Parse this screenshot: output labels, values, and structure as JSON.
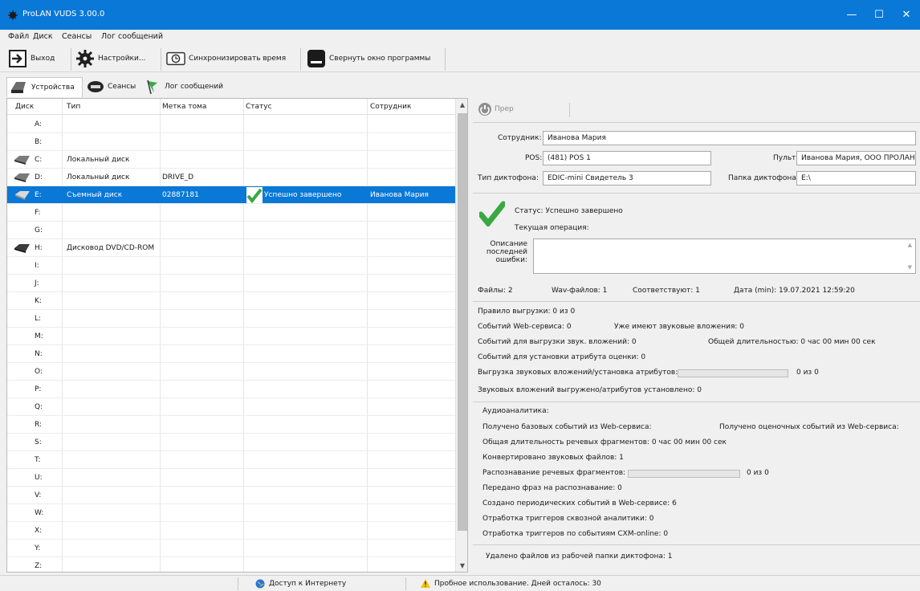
{
  "window": {
    "title": "ProLAN VUDS 3.00.0",
    "controls": [
      "—",
      "☐",
      "✕"
    ]
  },
  "menu": [
    "Файл",
    "Диск",
    "Сеансы",
    "Лог сообщений"
  ],
  "toolbar": {
    "exit": "Выход",
    "settings": "Настройки...",
    "sync": "Синхронизировать время",
    "minimize": "Свернуть окно программы"
  },
  "tabs": [
    "Устройства",
    "Сеансы",
    "Лог сообщений"
  ],
  "grid": {
    "headers": [
      "Диск",
      "Тип",
      "Метка тома",
      "Статус",
      "Сотрудник"
    ],
    "rows": [
      {
        "drive": "A:",
        "type": "",
        "label": "",
        "status": "",
        "user": ""
      },
      {
        "drive": "B:",
        "type": "",
        "label": "",
        "status": "",
        "user": ""
      },
      {
        "drive": "C:",
        "type": "Локальный диск",
        "label": "",
        "status": "",
        "user": ""
      },
      {
        "drive": "D:",
        "type": "Локальный диск",
        "label": "DRIVE_D",
        "status": "",
        "user": ""
      },
      {
        "drive": "E:",
        "type": "Съемный диск",
        "label": "02887181",
        "status": "Успешно завершено",
        "user": "Иванова Мария"
      },
      {
        "drive": "F:",
        "type": "",
        "label": "",
        "status": "",
        "user": ""
      },
      {
        "drive": "G:",
        "type": "",
        "label": "",
        "status": "",
        "user": ""
      },
      {
        "drive": "H:",
        "type": "Дисковод DVD/CD-ROM",
        "label": "",
        "status": "",
        "user": ""
      },
      {
        "drive": "I:",
        "type": "",
        "label": "",
        "status": "",
        "user": ""
      },
      {
        "drive": "J:",
        "type": "",
        "label": "",
        "status": "",
        "user": ""
      },
      {
        "drive": "K:",
        "type": "",
        "label": "",
        "status": "",
        "user": ""
      },
      {
        "drive": "L:",
        "type": "",
        "label": "",
        "status": "",
        "user": ""
      },
      {
        "drive": "M:",
        "type": "",
        "label": "",
        "status": "",
        "user": ""
      },
      {
        "drive": "N:",
        "type": "",
        "label": "",
        "status": "",
        "user": ""
      },
      {
        "drive": "O:",
        "type": "",
        "label": "",
        "status": "",
        "user": ""
      },
      {
        "drive": "P:",
        "type": "",
        "label": "",
        "status": "",
        "user": ""
      },
      {
        "drive": "Q:",
        "type": "",
        "label": "",
        "status": "",
        "user": ""
      },
      {
        "drive": "R:",
        "type": "",
        "label": "",
        "status": "",
        "user": ""
      },
      {
        "drive": "S:",
        "type": "",
        "label": "",
        "status": "",
        "user": ""
      },
      {
        "drive": "T:",
        "type": "",
        "label": "",
        "status": "",
        "user": ""
      },
      {
        "drive": "U:",
        "type": "",
        "label": "",
        "status": "",
        "user": ""
      },
      {
        "drive": "V:",
        "type": "",
        "label": "",
        "status": "",
        "user": ""
      },
      {
        "drive": "W:",
        "type": "",
        "label": "",
        "status": "",
        "user": ""
      },
      {
        "drive": "X:",
        "type": "",
        "label": "",
        "status": "",
        "user": ""
      },
      {
        "drive": "Y:",
        "type": "",
        "label": "",
        "status": "",
        "user": ""
      },
      {
        "drive": "Z:",
        "type": "",
        "label": "",
        "status": "",
        "user": ""
      }
    ]
  },
  "detail": {
    "prep_button": "Прер",
    "employee_label": "Сотрудник:",
    "employee_value": "Иванова Мария",
    "pos_label": "POS:",
    "pos_value": "(481) POS 1",
    "console_label": "Пульт:",
    "console_value": "Иванова Мария, ООО ПРОЛАН",
    "recorder_type_label": "Тип диктофона:",
    "recorder_type_value": "EDIC-mini Свидетель 3",
    "recorder_folder_label": "Папка диктофона:",
    "recorder_folder_value": "E:\\",
    "status_line": "Статус: Успешно завершено",
    "current_operation": "Текущая операция:",
    "last_error_label": "Описание последней ошибки:",
    "files": "Файлы: 2",
    "wav_files": "Wav-файлов: 1",
    "matching": "Соответствуют: 1",
    "date_min": "Дата (min): 19.07.2021 12:59:20",
    "upload_rule": "Правило выгрузки: 0 из 0",
    "web_events": "Событий Web-сервиса: 0",
    "already_have_audio": "Уже имеют звуковые вложения: 0",
    "events_for_upload": "Событий для выгрузки звук. вложений: 0",
    "total_duration": "Общей длительностью: 0 час 00 мин 00 сек",
    "events_for_rating": "Событий для установки атрибута оценки: 0",
    "upload_progress_label": "Выгрузка звуковых вложений/установка атрибутов:",
    "upload_progress_value": "0 из 0",
    "upload_progress_fraction": 0,
    "uploaded_total": "Звуковых вложений выгружено/атрибутов установлено: 0",
    "audio_analytics": "Аудиоаналитика:",
    "base_events_received": "Получено базовых событий из Web-сервиса:",
    "rating_events_received": "Получено оценочных событий из Web-сервиса:",
    "speech_total_duration": "Общая длительность речевых фрагментов: 0 час 00 мин 00 сек",
    "converted_files": "Конвертировано звуковых файлов: 1",
    "recognition_label": "Распознавание речевых фрагментов:",
    "recognition_value": "0 из 0",
    "recognition_fraction": 0,
    "phrases_sent": "Передано фраз на распознавание: 0",
    "periodic_events": "Создано периодических событий в Web-сервисе: 6",
    "triggers_through": "Отработка триггеров сквозной аналитики: 0",
    "triggers_cxm": "Отработка триггеров по событиям CXM-online: 0",
    "files_deleted": "Удалено файлов из рабочей папки диктофона: 1"
  },
  "statusbar": {
    "internet": "Доступ к Интернету",
    "trial": "Пробное использование. Дней осталось: 30"
  }
}
